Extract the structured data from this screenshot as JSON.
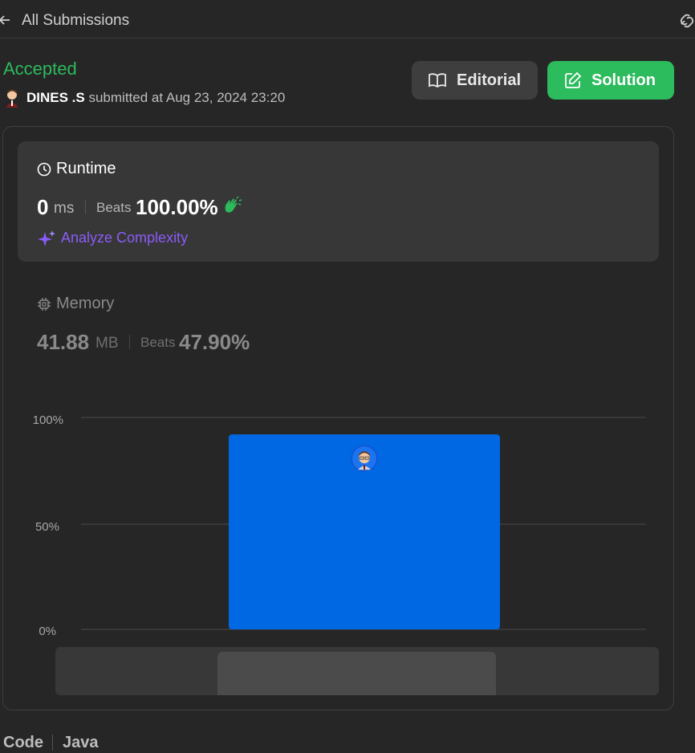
{
  "topbar": {
    "title": "All Submissions"
  },
  "submission": {
    "status": "Accepted",
    "status_color": "#2cbb5d",
    "author": "DINES .S",
    "submitted_text": " submitted at Aug 23, 2024 23:20"
  },
  "buttons": {
    "editorial": "Editorial",
    "solution": "Solution"
  },
  "runtime": {
    "title": "Runtime",
    "value": "0",
    "unit": "ms",
    "beats_label": "Beats",
    "beats_value": "100.00%",
    "analyze_label": "Analyze Complexity"
  },
  "memory": {
    "title": "Memory",
    "value": "41.88",
    "unit": "MB",
    "beats_label": "Beats",
    "beats_value": "47.90%"
  },
  "chart_data": {
    "type": "bar",
    "y_ticks": [
      "100%",
      "50%",
      "0%"
    ],
    "ylim": [
      0,
      100
    ],
    "bar_value": 92,
    "bar_color": "#0068e3",
    "grid": true
  },
  "code_section": {
    "label": "Code",
    "language": "Java"
  },
  "icons": [
    "back-arrow-icon",
    "link-icon",
    "avatar-icon",
    "book-icon",
    "edit-icon",
    "clock-icon",
    "clap-icon",
    "sparkle-icon",
    "chip-icon"
  ]
}
